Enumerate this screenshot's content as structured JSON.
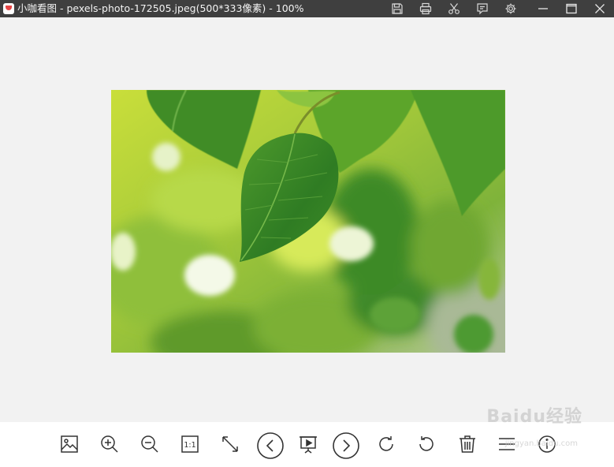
{
  "window": {
    "title": "小咖看图 - pexels-photo-172505.jpeg(500*333像素) - 100%"
  },
  "title_tools": [
    {
      "icon": "save-icon"
    },
    {
      "icon": "print-icon"
    },
    {
      "icon": "scissors-icon"
    },
    {
      "icon": "feedback-icon"
    },
    {
      "icon": "gear-icon"
    }
  ],
  "window_controls": [
    {
      "icon": "minimize-icon"
    },
    {
      "icon": "maximize-icon"
    },
    {
      "icon": "close-icon"
    }
  ],
  "image": {
    "subject": "green-leaf-photo"
  },
  "toolbar": {
    "actual_size_label": "1:1",
    "tools": [
      {
        "icon": "image-icon"
      },
      {
        "icon": "zoom-in-icon"
      },
      {
        "icon": "zoom-out-icon"
      },
      {
        "icon": "actual-size-icon"
      },
      {
        "icon": "fit-window-icon"
      },
      {
        "icon": "previous-icon"
      },
      {
        "icon": "slideshow-icon"
      },
      {
        "icon": "next-icon"
      },
      {
        "icon": "rotate-right-icon"
      },
      {
        "icon": "rotate-left-icon"
      },
      {
        "icon": "trash-icon"
      },
      {
        "icon": "menu-icon"
      },
      {
        "icon": "info-icon"
      }
    ]
  },
  "watermark": {
    "text": "Baidu经验",
    "sub": "jingyan.baidu.com"
  },
  "colors": {
    "titlebar": "#3f3f3f",
    "canvas": "#f2f2f2",
    "toolbar": "#ffffff",
    "icon": "#333333"
  }
}
